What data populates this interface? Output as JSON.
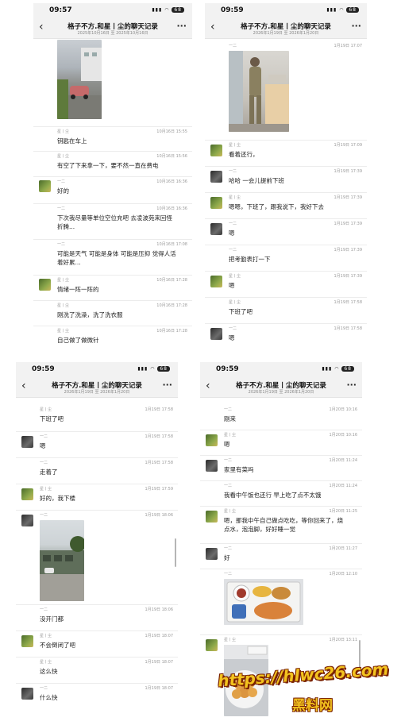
{
  "panels": [
    {
      "status_time": "09:57",
      "battery": "68",
      "title": "格子不方.和星丨尘的聊天记录",
      "subtitle": "2025年10月16日 至 2025年10月16日",
      "messages": [
        {
          "name": "星丨尘",
          "time": "10月16日 15:55",
          "text": "钥匙在车上"
        },
        {
          "name": "星丨尘",
          "time": "10月16日 15:56",
          "text": "有空了下来拿一下，要不然一直在费电"
        },
        {
          "name": "一二",
          "time": "10月16日 16:36",
          "text": "好的"
        },
        {
          "name": "一二",
          "time": "10月16日 16:36",
          "text": "下次我尽量等单位空位充吧 去凌波苑来回怪折腾..."
        },
        {
          "name": "一二",
          "time": "10月16日 17:08",
          "text": "可能是天气 可能是身体 可能是压抑 觉得人活着好累..."
        },
        {
          "name": "星丨尘",
          "time": "10月16日 17:28",
          "text": "情绪一阵一阵的"
        },
        {
          "name": "星丨尘",
          "time": "10月16日 17:28",
          "text": "刚洗了洗澡，洗了洗衣服"
        },
        {
          "name": "星丨尘",
          "time": "10月16日 17:28",
          "text": "自己做了做微针"
        }
      ]
    },
    {
      "status_time": "09:59",
      "battery": "68",
      "title": "格子不方.和星丨尘的聊天记录",
      "subtitle": "2026年1月19日 至 2026年1月20日",
      "messages": [
        {
          "name": "一二",
          "time": "1月19日 17:07",
          "text": ""
        },
        {
          "name": "星丨尘",
          "time": "1月19日 17:09",
          "text": "看着还行，"
        },
        {
          "name": "一二",
          "time": "1月19日 17:39",
          "text": "哈哈 一会儿提前下班"
        },
        {
          "name": "星丨尘",
          "time": "1月19日 17:39",
          "text": "嗯嗯，下班了，跟我说下，我好下去"
        },
        {
          "name": "一二",
          "time": "1月19日 17:39",
          "text": "嗯"
        },
        {
          "name": "一二",
          "time": "1月19日 17:39",
          "text": "把考勤表打一下"
        },
        {
          "name": "星丨尘",
          "time": "1月19日 17:39",
          "text": "嗯"
        },
        {
          "name": "星丨尘",
          "time": "1月19日 17:58",
          "text": "下班了吧"
        },
        {
          "name": "一二",
          "time": "1月19日 17:58",
          "text": "嗯"
        }
      ]
    },
    {
      "status_time": "09:59",
      "battery": "68",
      "title": "格子不方.和星丨尘的聊天记录",
      "subtitle": "2026年1月19日 至 2026年1月20日",
      "messages": [
        {
          "name": "星丨尘",
          "time": "1月19日 17:58",
          "text": "下班了吧"
        },
        {
          "name": "一二",
          "time": "1月19日 17:58",
          "text": "嗯"
        },
        {
          "name": "一二",
          "time": "1月19日 17:58",
          "text": "走着了"
        },
        {
          "name": "星丨尘",
          "time": "1月19日 17:59",
          "text": "好的，我下楼"
        },
        {
          "name": "一二",
          "time": "1月19日 18:06",
          "text": ""
        },
        {
          "name": "一二",
          "time": "1月19日 18:06",
          "text": "没开门都"
        },
        {
          "name": "星丨尘",
          "time": "1月19日 18:07",
          "text": "不会倒闭了吧"
        },
        {
          "name": "星丨尘",
          "time": "1月19日 18:07",
          "text": "这么快"
        },
        {
          "name": "一二",
          "time": "1月19日 18:07",
          "text": "什么快"
        }
      ]
    },
    {
      "status_time": "09:59",
      "battery": "68",
      "title": "格子不方.和星丨尘的聊天记录",
      "subtitle": "2026年1月19日 至 2026年1月20日",
      "messages": [
        {
          "name": "一二",
          "time": "1月20日 10:16",
          "text": "刚来"
        },
        {
          "name": "星丨尘",
          "time": "1月20日 10:16",
          "text": "嗯"
        },
        {
          "name": "一二",
          "time": "1月20日 11:24",
          "text": "家里有菜吗"
        },
        {
          "name": "一二",
          "time": "1月20日 11:24",
          "text": "我看中午饭也还行 早上吃了点不太饿"
        },
        {
          "name": "星丨尘",
          "time": "1月20日 11:25",
          "text": "嗯，那我中午自己做点吃吃，等你回来了，烧点水，泡泡脚，好好睡一觉"
        },
        {
          "name": "一二",
          "time": "1月20日 11:27",
          "text": "好"
        },
        {
          "name": "一二",
          "time": "1月20日 12:10",
          "text": ""
        },
        {
          "name": "星丨尘",
          "time": "1月20日 13:11",
          "text": ""
        }
      ]
    }
  ],
  "icons": {
    "back": "chevron-left-icon",
    "more": "more-dots-icon",
    "wifi": "wifi-icon",
    "signal": "signal-icon",
    "battery": "battery-icon"
  },
  "watermark": {
    "line1": "https://hlwc26.com",
    "line2": "黑料网"
  }
}
